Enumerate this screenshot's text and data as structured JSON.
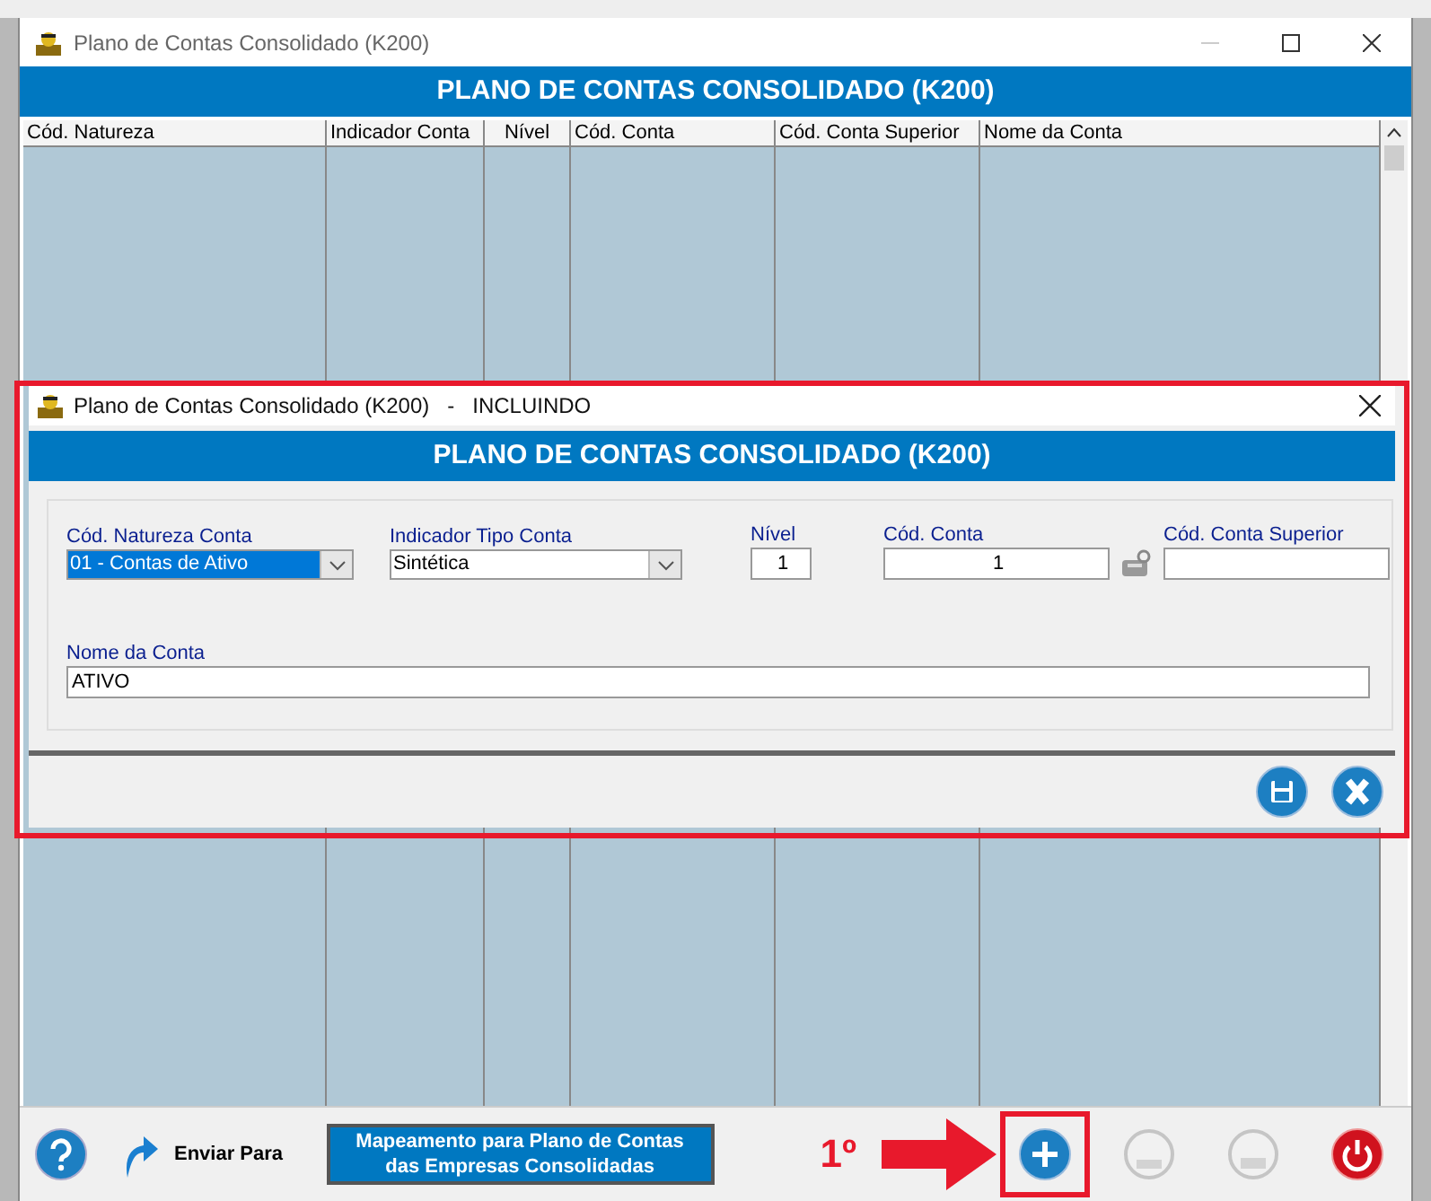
{
  "window": {
    "title": "Plano de Contas Consolidado (K200)",
    "header": "PLANO DE CONTAS CONSOLIDADO (K200)"
  },
  "table": {
    "columns": [
      "Cód. Natureza",
      "Indicador Conta",
      "Nível",
      "Cód. Conta",
      "Cód. Conta Superior",
      "Nome da Conta"
    ]
  },
  "dialog": {
    "title": "Plano de Contas Consolidado (K200)   -   INCLUINDO",
    "header": "PLANO DE CONTAS CONSOLIDADO (K200)",
    "fields": [
      {
        "kind": "combo",
        "label": "Cód. Natureza Conta",
        "value": "01 - Contas de Ativo",
        "selected": true
      },
      {
        "kind": "combo",
        "label": "Indicador Tipo Conta",
        "value": "Sintética",
        "selected": false
      },
      {
        "kind": "number",
        "label": "Nível",
        "value": "1"
      },
      {
        "kind": "number",
        "label": "Cód. Conta",
        "value": "1"
      },
      {
        "kind": "lookup",
        "label": "Cód. Conta Superior"
      }
    ],
    "name_field": {
      "label": "Nome da Conta",
      "value": "ATIVO"
    }
  },
  "toolbar": {
    "send_label": "Enviar Para",
    "mapping_button": [
      "Mapeamento para Plano de Contas",
      "das Empresas Consolidadas"
    ],
    "step_label": "1º",
    "buttons": [
      {
        "kind": "add",
        "disabled": false
      },
      {
        "kind": "edit",
        "disabled": true
      },
      {
        "kind": "delete",
        "disabled": true
      },
      {
        "kind": "exit",
        "disabled": false
      }
    ]
  }
}
